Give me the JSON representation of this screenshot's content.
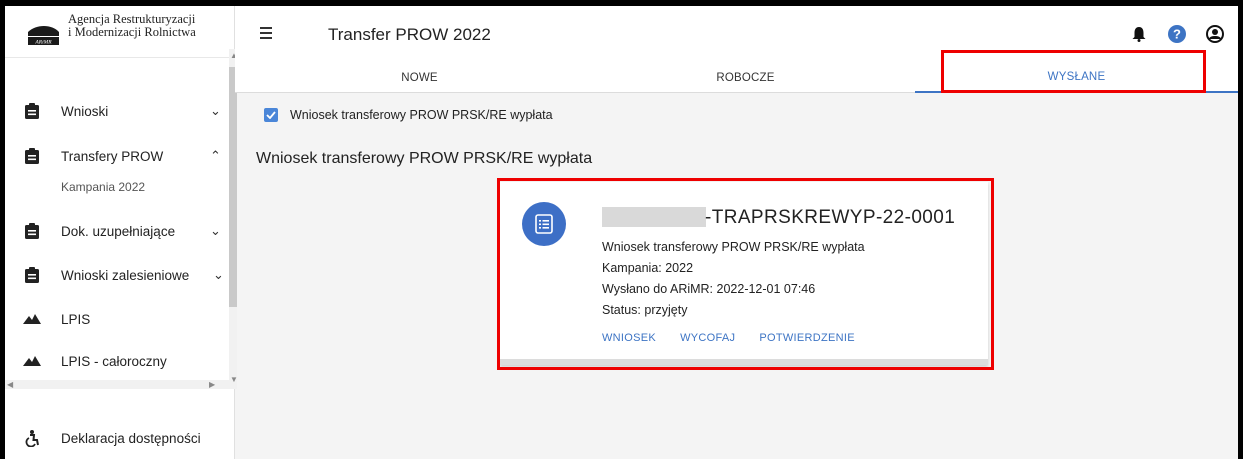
{
  "logo": {
    "line1": "Agencja Restrukturyzacji",
    "line2": "i Modernizacji Rolnictwa",
    "mark_text": "ARiMR"
  },
  "header": {
    "title": "Transfer PROW 2022",
    "icons": [
      "bell-icon",
      "help-icon",
      "account-icon"
    ]
  },
  "tabs": [
    {
      "label": "NOWE",
      "active": false
    },
    {
      "label": "ROBOCZE",
      "active": false
    },
    {
      "label": "WYSŁANE",
      "active": true
    }
  ],
  "sidebar": {
    "items": [
      {
        "label": "Wnioski",
        "icon": "clipboard-icon",
        "chevron": "⌄"
      },
      {
        "label": "Transfery PROW",
        "icon": "clipboard-icon",
        "chevron": "⌃"
      },
      {
        "label": "Dok. uzupełniające",
        "icon": "clipboard-icon",
        "chevron": "⌄"
      },
      {
        "label": "Wnioski zalesieniowe",
        "icon": "clipboard-icon",
        "chevron": "⌄"
      },
      {
        "label": "LPIS",
        "icon": "mountain-icon"
      },
      {
        "label": "LPIS - całoroczny",
        "icon": "mountain-icon"
      },
      {
        "label": "Deklaracja dostępności",
        "icon": "accessibility-icon"
      }
    ],
    "subitem": "Kampania 2022"
  },
  "filter": {
    "label": "Wniosek transferowy PROW PRSK/RE wypłata",
    "checked": true
  },
  "section": {
    "title": "Wniosek transferowy PROW PRSK/RE wypłata"
  },
  "card": {
    "id_suffix": "-TRAPRSKREWYP-22-0001",
    "type": "Wniosek transferowy PROW PRSK/RE wypłata",
    "campaign": "Kampania: 2022",
    "sent": "Wysłano do ARiMR: 2022-12-01 07:46",
    "status": "Status: przyjęty",
    "actions": [
      "WNIOSEK",
      "WYCOFAJ",
      "POTWIERDZENIE"
    ]
  },
  "colors": {
    "accent": "#3d74c4",
    "highlight": "#e00000",
    "avatar": "#3d6fc6"
  }
}
